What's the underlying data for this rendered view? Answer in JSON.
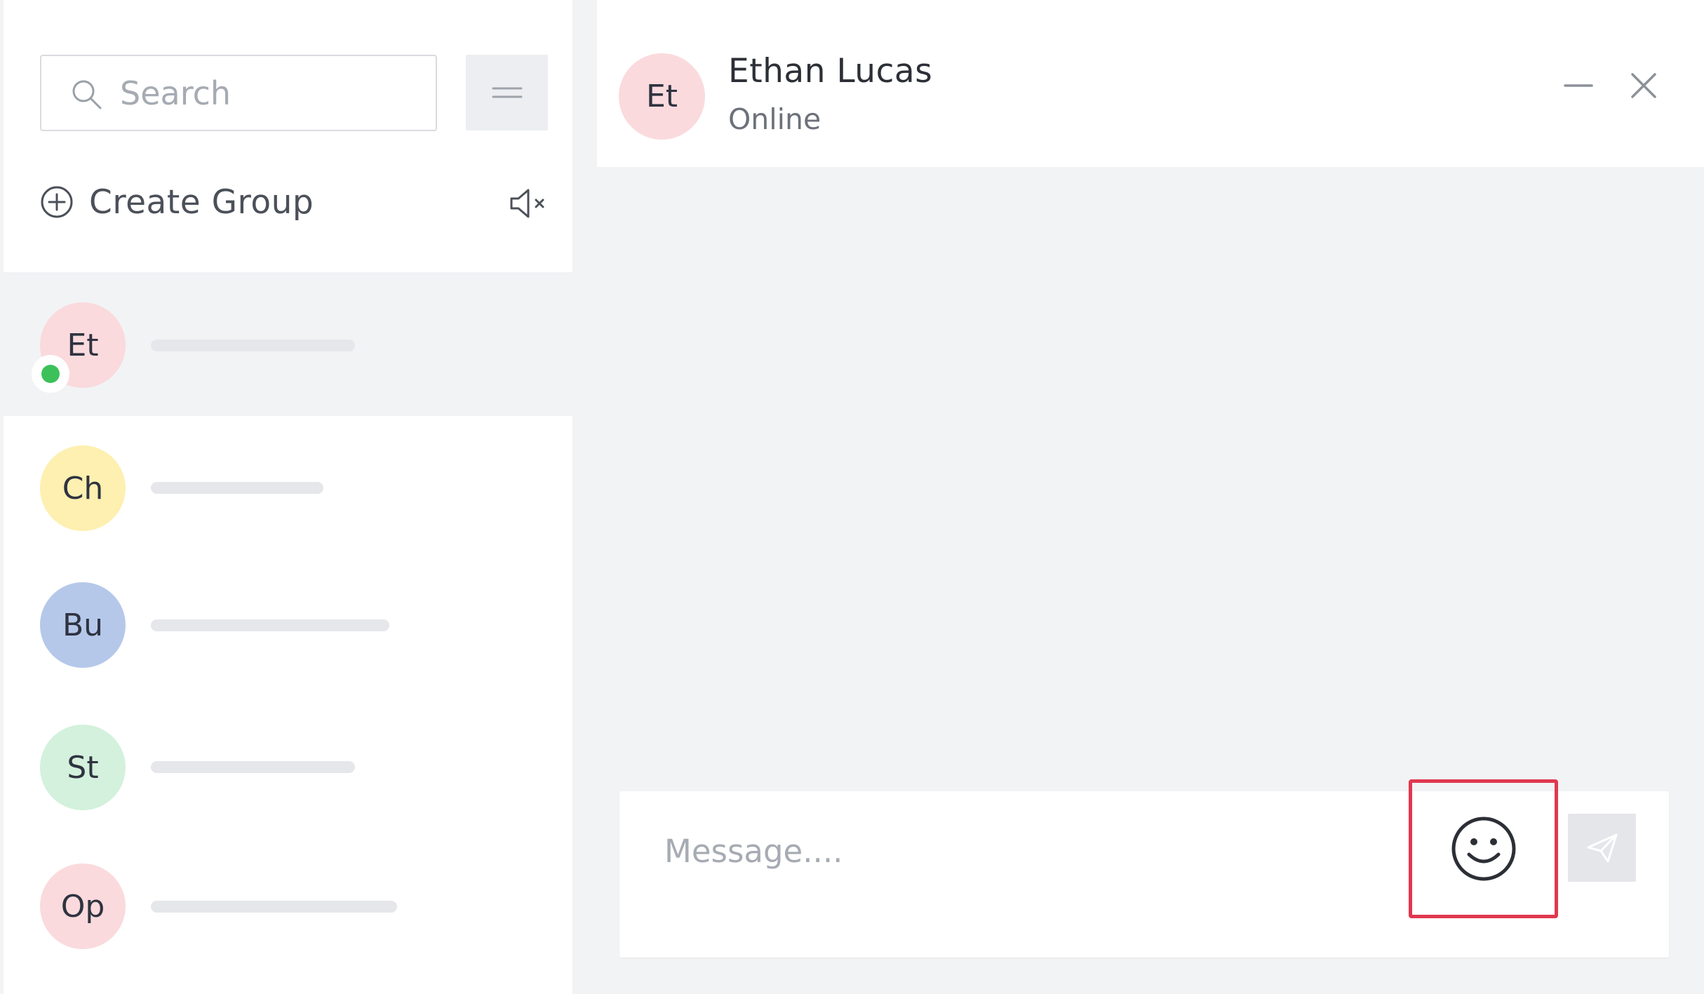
{
  "search": {
    "placeholder": "Search"
  },
  "sidebar": {
    "create_group_label": "Create Group",
    "contacts": [
      {
        "initials": "Et",
        "avatar_color": "#fadadd",
        "online": true
      },
      {
        "initials": "Ch",
        "avatar_color": "#fdf0b0",
        "online": false
      },
      {
        "initials": "Bu",
        "avatar_color": "#b5c8ea",
        "online": false
      },
      {
        "initials": "St",
        "avatar_color": "#d3f1dc",
        "online": false
      },
      {
        "initials": "Op",
        "avatar_color": "#fadadd",
        "online": false
      }
    ]
  },
  "chat": {
    "initials": "Et",
    "avatar_color": "#fadadd",
    "name": "Ethan Lucas",
    "status": "Online",
    "message_placeholder": "Message...."
  },
  "colors": {
    "online_dot": "#3cc15a",
    "highlight_border": "#e0384f",
    "active_row": "#f2f3f5"
  },
  "icons": {
    "search": "search-icon",
    "menu": "menu-icon",
    "create_group": "plus-circle-icon",
    "mute": "speaker-mute-icon",
    "minimize": "minimize-icon",
    "close": "close-icon",
    "emoji": "smiley-icon",
    "send": "send-icon"
  }
}
